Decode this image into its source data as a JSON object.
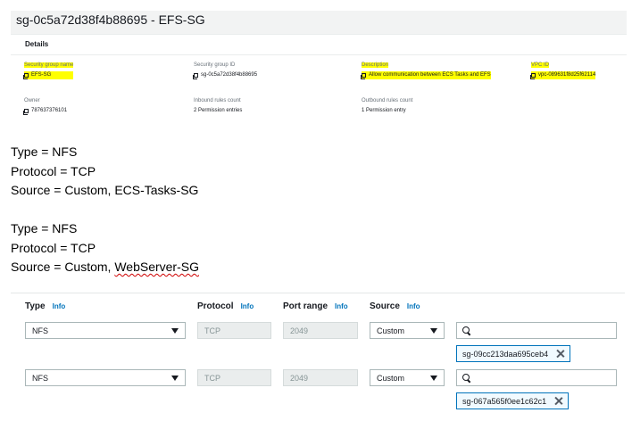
{
  "security_group": {
    "title": "sg-0c5a72d38f4b88695 - EFS-SG",
    "details_header": "Details",
    "fields": {
      "name": {
        "label": "Security group name",
        "value": "EFS-SG"
      },
      "id": {
        "label": "Security group ID",
        "value": "sg-0c5a72d38f4b88695"
      },
      "description": {
        "label": "Description",
        "value": "Allow communication between ECS Tasks and EFS"
      },
      "vpc": {
        "label": "VPC ID",
        "value": "vpc-089631f8d25f62114"
      },
      "owner": {
        "label": "Owner",
        "value": "787637376101"
      },
      "inbound": {
        "label": "Inbound rules count",
        "value": "2 Permission entries"
      },
      "outbound": {
        "label": "Outbound rules count",
        "value": "1 Permission entry"
      }
    }
  },
  "notes": {
    "block1": [
      "Type = NFS",
      "Protocol = TCP",
      "Source = Custom, ECS-Tasks-SG"
    ],
    "block2": [
      "Type = NFS",
      "Protocol = TCP"
    ],
    "block2_source_prefix": "Source = Custom, ",
    "block2_source_name": "WebServer-SG"
  },
  "rules": {
    "headers": {
      "type": "Type",
      "protocol": "Protocol",
      "port_range": "Port range",
      "source": "Source",
      "info": "Info"
    },
    "rows": [
      {
        "type": "NFS",
        "protocol": "TCP",
        "port_range": "2049",
        "source": "Custom",
        "search_value": "",
        "token": "sg-09cc213daa695ceb4"
      },
      {
        "type": "NFS",
        "protocol": "TCP",
        "port_range": "2049",
        "source": "Custom",
        "search_value": "",
        "token": "sg-067a565f0ee1c62c1"
      }
    ]
  },
  "colors": {
    "highlight": "#ffff00",
    "info_link": "#0073bb",
    "token_border": "#0073bb",
    "panel_bg": "#f2f3f3"
  }
}
